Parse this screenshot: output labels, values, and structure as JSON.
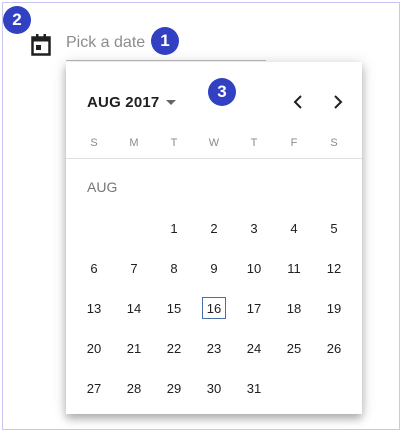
{
  "annotations": [
    "1",
    "2",
    "3"
  ],
  "date_input": {
    "placeholder": "Pick a date"
  },
  "calendar": {
    "period_label": "AUG 2017",
    "month_label": "AUG",
    "weekdays": [
      "S",
      "M",
      "T",
      "W",
      "T",
      "F",
      "S"
    ],
    "weeks": [
      [
        "",
        "",
        "1",
        "2",
        "3",
        "4",
        "5"
      ],
      [
        "6",
        "7",
        "8",
        "9",
        "10",
        "11",
        "12"
      ],
      [
        "13",
        "14",
        "15",
        "16",
        "17",
        "18",
        "19"
      ],
      [
        "20",
        "21",
        "22",
        "23",
        "24",
        "25",
        "26"
      ],
      [
        "27",
        "28",
        "29",
        "30",
        "31",
        "",
        ""
      ]
    ],
    "today": "16"
  },
  "colors": {
    "badge": "#3240c2",
    "today_border": "#4a6fa8"
  }
}
